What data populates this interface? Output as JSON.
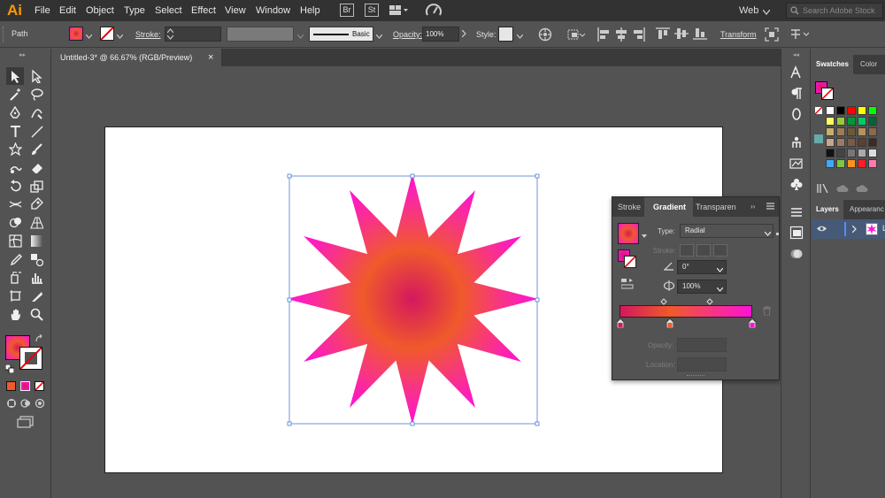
{
  "app": {
    "logo": "Ai"
  },
  "menu": {
    "items": [
      "File",
      "Edit",
      "Object",
      "Type",
      "Select",
      "Effect",
      "View",
      "Window",
      "Help"
    ],
    "badges": [
      "Br",
      "St"
    ],
    "workspace": "Web",
    "search_placeholder": "Search Adobe Stock"
  },
  "control": {
    "selection_label": "Path",
    "stroke_label": "Stroke:",
    "brush_label": "Basic",
    "opacity_label": "Opacity:",
    "opacity_value": "100%",
    "style_label": "Style:",
    "transform_label": "Transform"
  },
  "document": {
    "tab_title": "Untitled-3* @ 66.67% (RGB/Preview)",
    "close_glyph": "×"
  },
  "gradient_panel": {
    "tabs": [
      "Stroke",
      "Gradient",
      "Transparen"
    ],
    "type_label": "Type:",
    "type_value": "Radial",
    "stroke_label": "Stroke:",
    "angle_value": "0°",
    "aspect_value": "100%",
    "opacity_label": "Opacity:",
    "location_label": "Location:"
  },
  "swatches_panel": {
    "tabs": [
      "Swatches",
      "Color"
    ],
    "rows": [
      [
        "#ffffff",
        "#000000",
        "#ff0000",
        "#ffff00",
        "#00ff00"
      ],
      [
        "#ffff66",
        "#99cc33",
        "#009933",
        "#00cc66",
        "#006633"
      ],
      [
        "#c8b06a",
        "#9f7d50",
        "#6b5a3a",
        "#b8915a",
        "#8a6a4a"
      ],
      [
        "#c7a78a",
        "#a07a60",
        "#7a5a48",
        "#5c4030",
        "#3e2a20"
      ],
      [
        "#111111",
        "#444444",
        "#777777",
        "#aaaaaa",
        "#dddddd"
      ],
      [
        "#3fa9f5",
        "#7ac943",
        "#f7931e",
        "#ff1d25",
        "#ff7bac"
      ]
    ]
  },
  "layers_panel": {
    "tabs": [
      "Layers",
      "Appearanc"
    ],
    "layer_name": "L"
  },
  "colors": {
    "accent_magenta": "#ff12d6",
    "gradient_center": "#d4185e",
    "gradient_mid": "#f05a2a",
    "selection_blue": "#4a7bd6"
  },
  "tools": [
    "selection-tool",
    "direct-selection-tool",
    "magic-wand-tool",
    "lasso-tool",
    "pen-tool",
    "curvature-tool",
    "type-tool",
    "line-tool",
    "rectangle-tool",
    "paintbrush-tool",
    "shaper-tool",
    "eraser-tool",
    "rotate-tool",
    "scale-tool",
    "width-tool",
    "puppet-warp-tool",
    "shape-builder-tool",
    "perspective-grid-tool",
    "mesh-tool",
    "gradient-tool",
    "eyedropper-tool",
    "blend-tool",
    "symbol-sprayer-tool",
    "column-graph-tool",
    "artboard-tool",
    "slice-tool",
    "hand-tool",
    "zoom-tool"
  ],
  "strip_icons": [
    "character-icon",
    "paragraph-icon",
    "opentype-icon",
    "puppet-icon",
    "image-trace-icon",
    "club-icon",
    "align-icon",
    "gradient-swatch-icon",
    "transparency-icon"
  ]
}
